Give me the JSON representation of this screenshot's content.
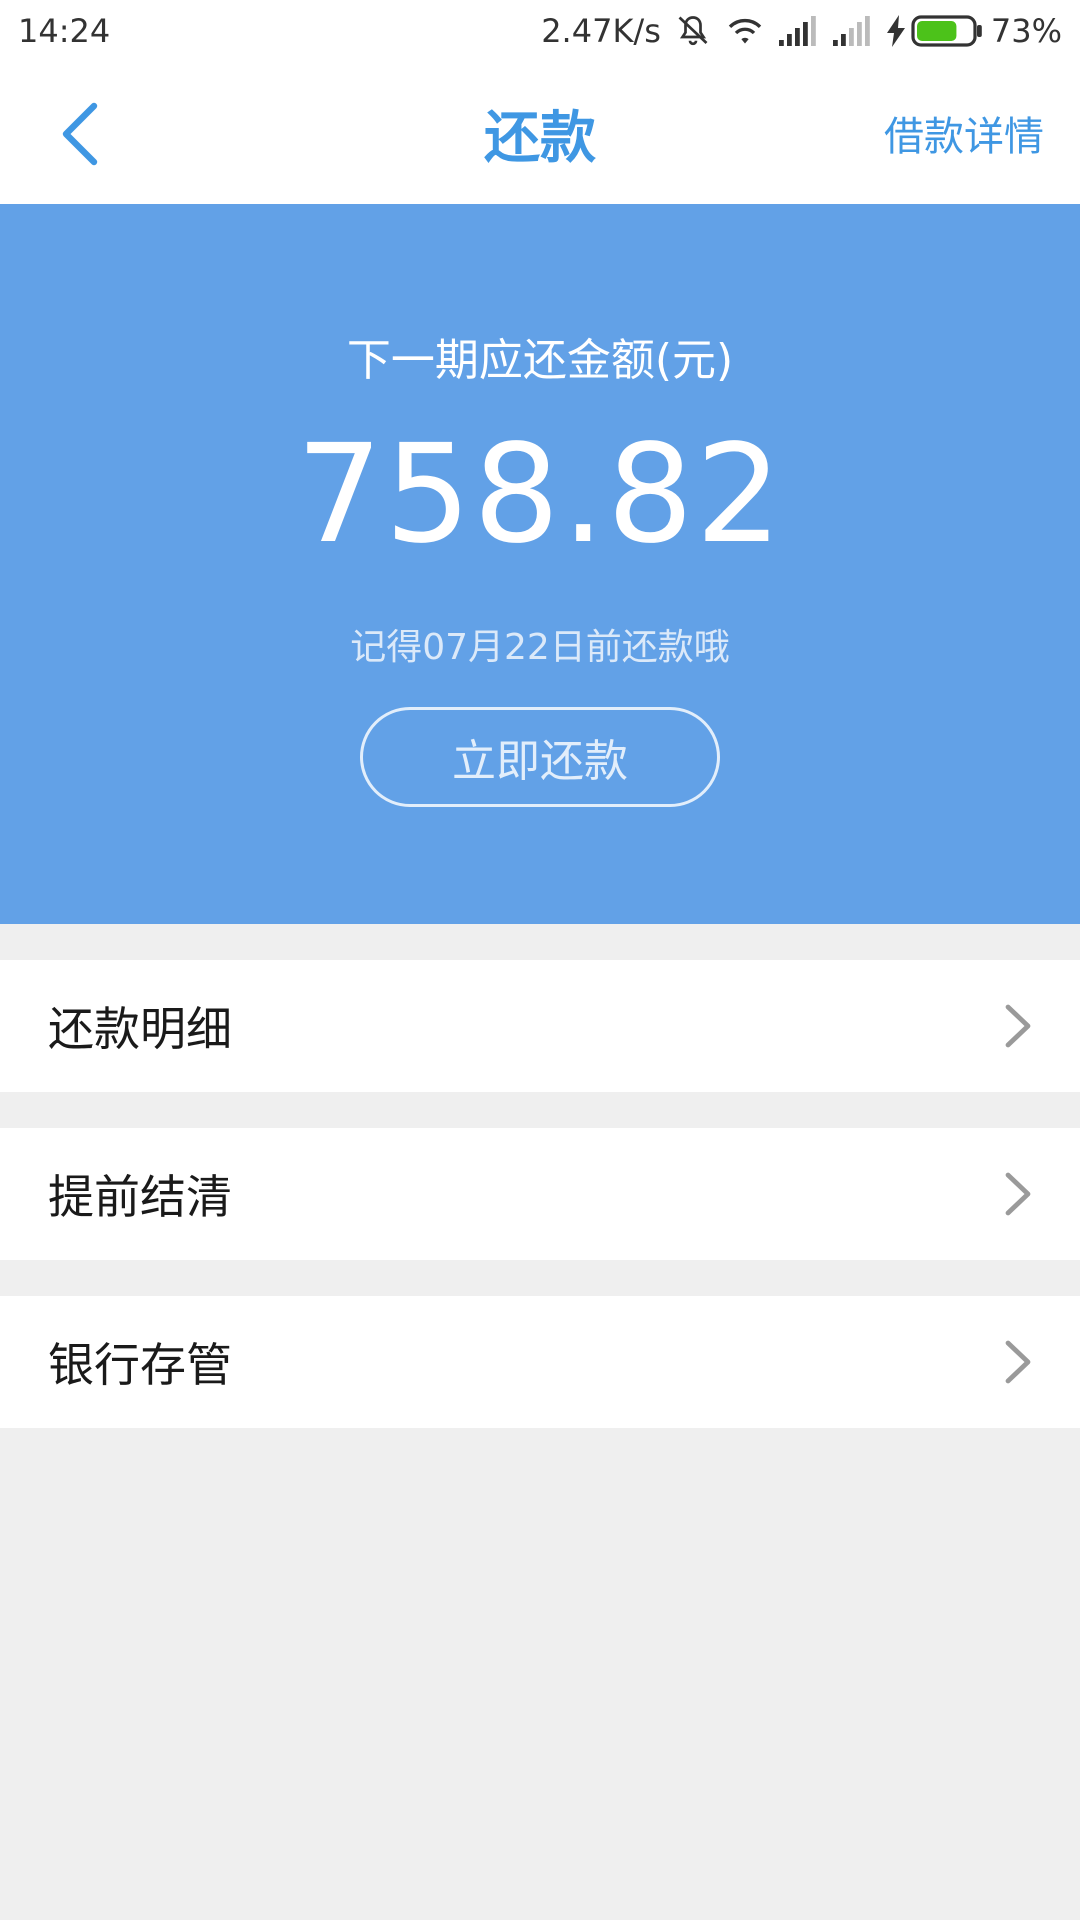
{
  "status_bar": {
    "time": "14:24",
    "network_speed": "2.47K/s",
    "battery_percent": "73%",
    "battery_level": 0.73,
    "icons": [
      "bell-muted-icon",
      "wifi-icon",
      "signal-icon",
      "signal-icon",
      "charging-icon",
      "battery-icon"
    ]
  },
  "nav": {
    "back_icon": "chevron-left-icon",
    "title": "还款",
    "right_link": "借款详情"
  },
  "hero": {
    "label": "下一期应还金额(元)",
    "amount": "758.82",
    "reminder": "记得07月22日前还款哦",
    "button_label": "立即还款"
  },
  "menu": {
    "items": [
      {
        "label": "还款明细",
        "icon": "chevron-right-icon"
      },
      {
        "label": "提前结清",
        "icon": "chevron-right-icon"
      },
      {
        "label": "银行存管",
        "icon": "chevron-right-icon"
      }
    ]
  },
  "colors": {
    "accent": "#3f97e3",
    "hero_background": "#62a1e7",
    "page_background": "#efefef",
    "battery_fill": "#4cc21a"
  }
}
